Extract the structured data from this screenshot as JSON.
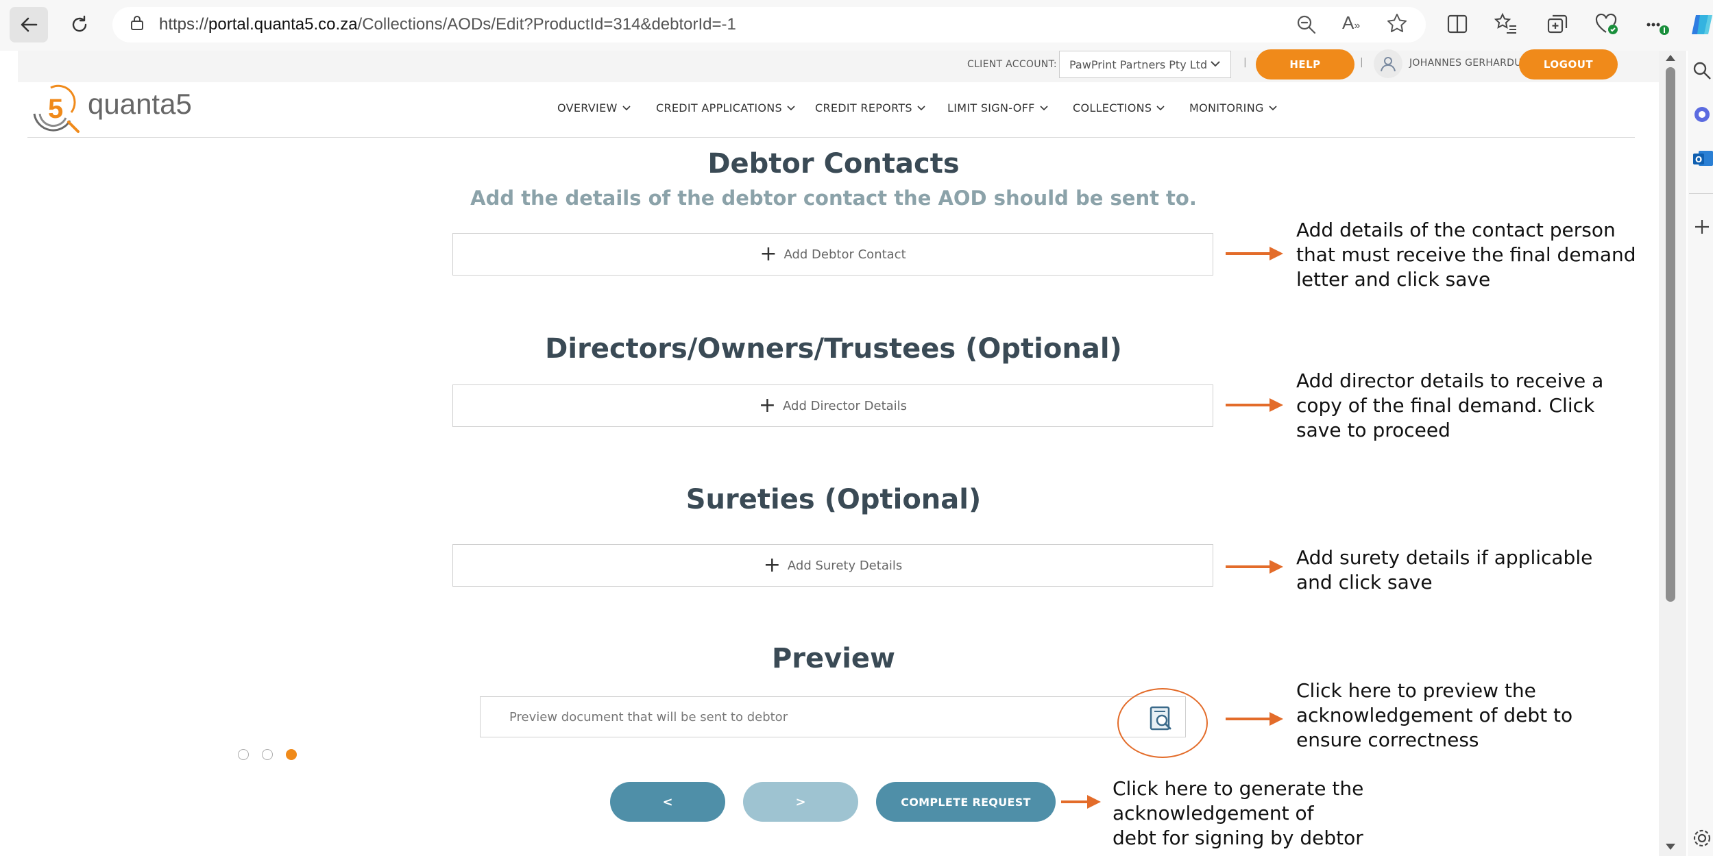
{
  "browser": {
    "url_prefix": "https://",
    "url_host": "portal.quanta5.co.za",
    "url_path": "/Collections/AODs/Edit?ProductId=314&debtorId=-1"
  },
  "header": {
    "client_account_label": "CLIENT ACCOUNT:",
    "client_account_value": "PawPrint Partners Pty Ltd",
    "separator": "|",
    "help_label": "HELP",
    "user_name": "JOHANNES GERHARDUS",
    "logout_label": "LOGOUT",
    "logo_text": "quanta5",
    "accent_color": "#f08a1a"
  },
  "nav": {
    "items": [
      {
        "label": "OVERVIEW"
      },
      {
        "label": "CREDIT APPLICATIONS"
      },
      {
        "label": "CREDIT REPORTS"
      },
      {
        "label": "LIMIT SIGN-OFF"
      },
      {
        "label": "COLLECTIONS"
      },
      {
        "label": "MONITORING"
      }
    ]
  },
  "sections": {
    "debtor_contacts": {
      "title": "Debtor Contacts",
      "subtitle": "Add the details of the debtor contact the AOD should be sent to.",
      "button": "Add Debtor Contact"
    },
    "directors": {
      "title": "Directors/Owners/Trustees (Optional)",
      "button": "Add Director Details"
    },
    "sureties": {
      "title": "Sureties (Optional)",
      "button": "Add Surety Details"
    },
    "preview": {
      "title": "Preview",
      "placeholder": "Preview document that will be sent to debtor"
    }
  },
  "stepper": {
    "total": 3,
    "active": 3
  },
  "footer_buttons": {
    "back": "<",
    "next": ">",
    "complete": "COMPLETE REQUEST"
  },
  "annotations": {
    "debtor_contact": [
      "Add details of the contact person",
      "that must receive the final demand",
      "letter and click save"
    ],
    "director": [
      "Add director details to receive a",
      "copy of the final demand. Click",
      "save to proceed"
    ],
    "surety": [
      "Add surety details if applicable",
      "and click save"
    ],
    "preview": [
      "Click here to preview the",
      "acknowledgement of debt to",
      "ensure correctness"
    ],
    "complete": [
      "Click here to generate the",
      "acknowledgement of",
      "debt for signing by debtor"
    ]
  }
}
